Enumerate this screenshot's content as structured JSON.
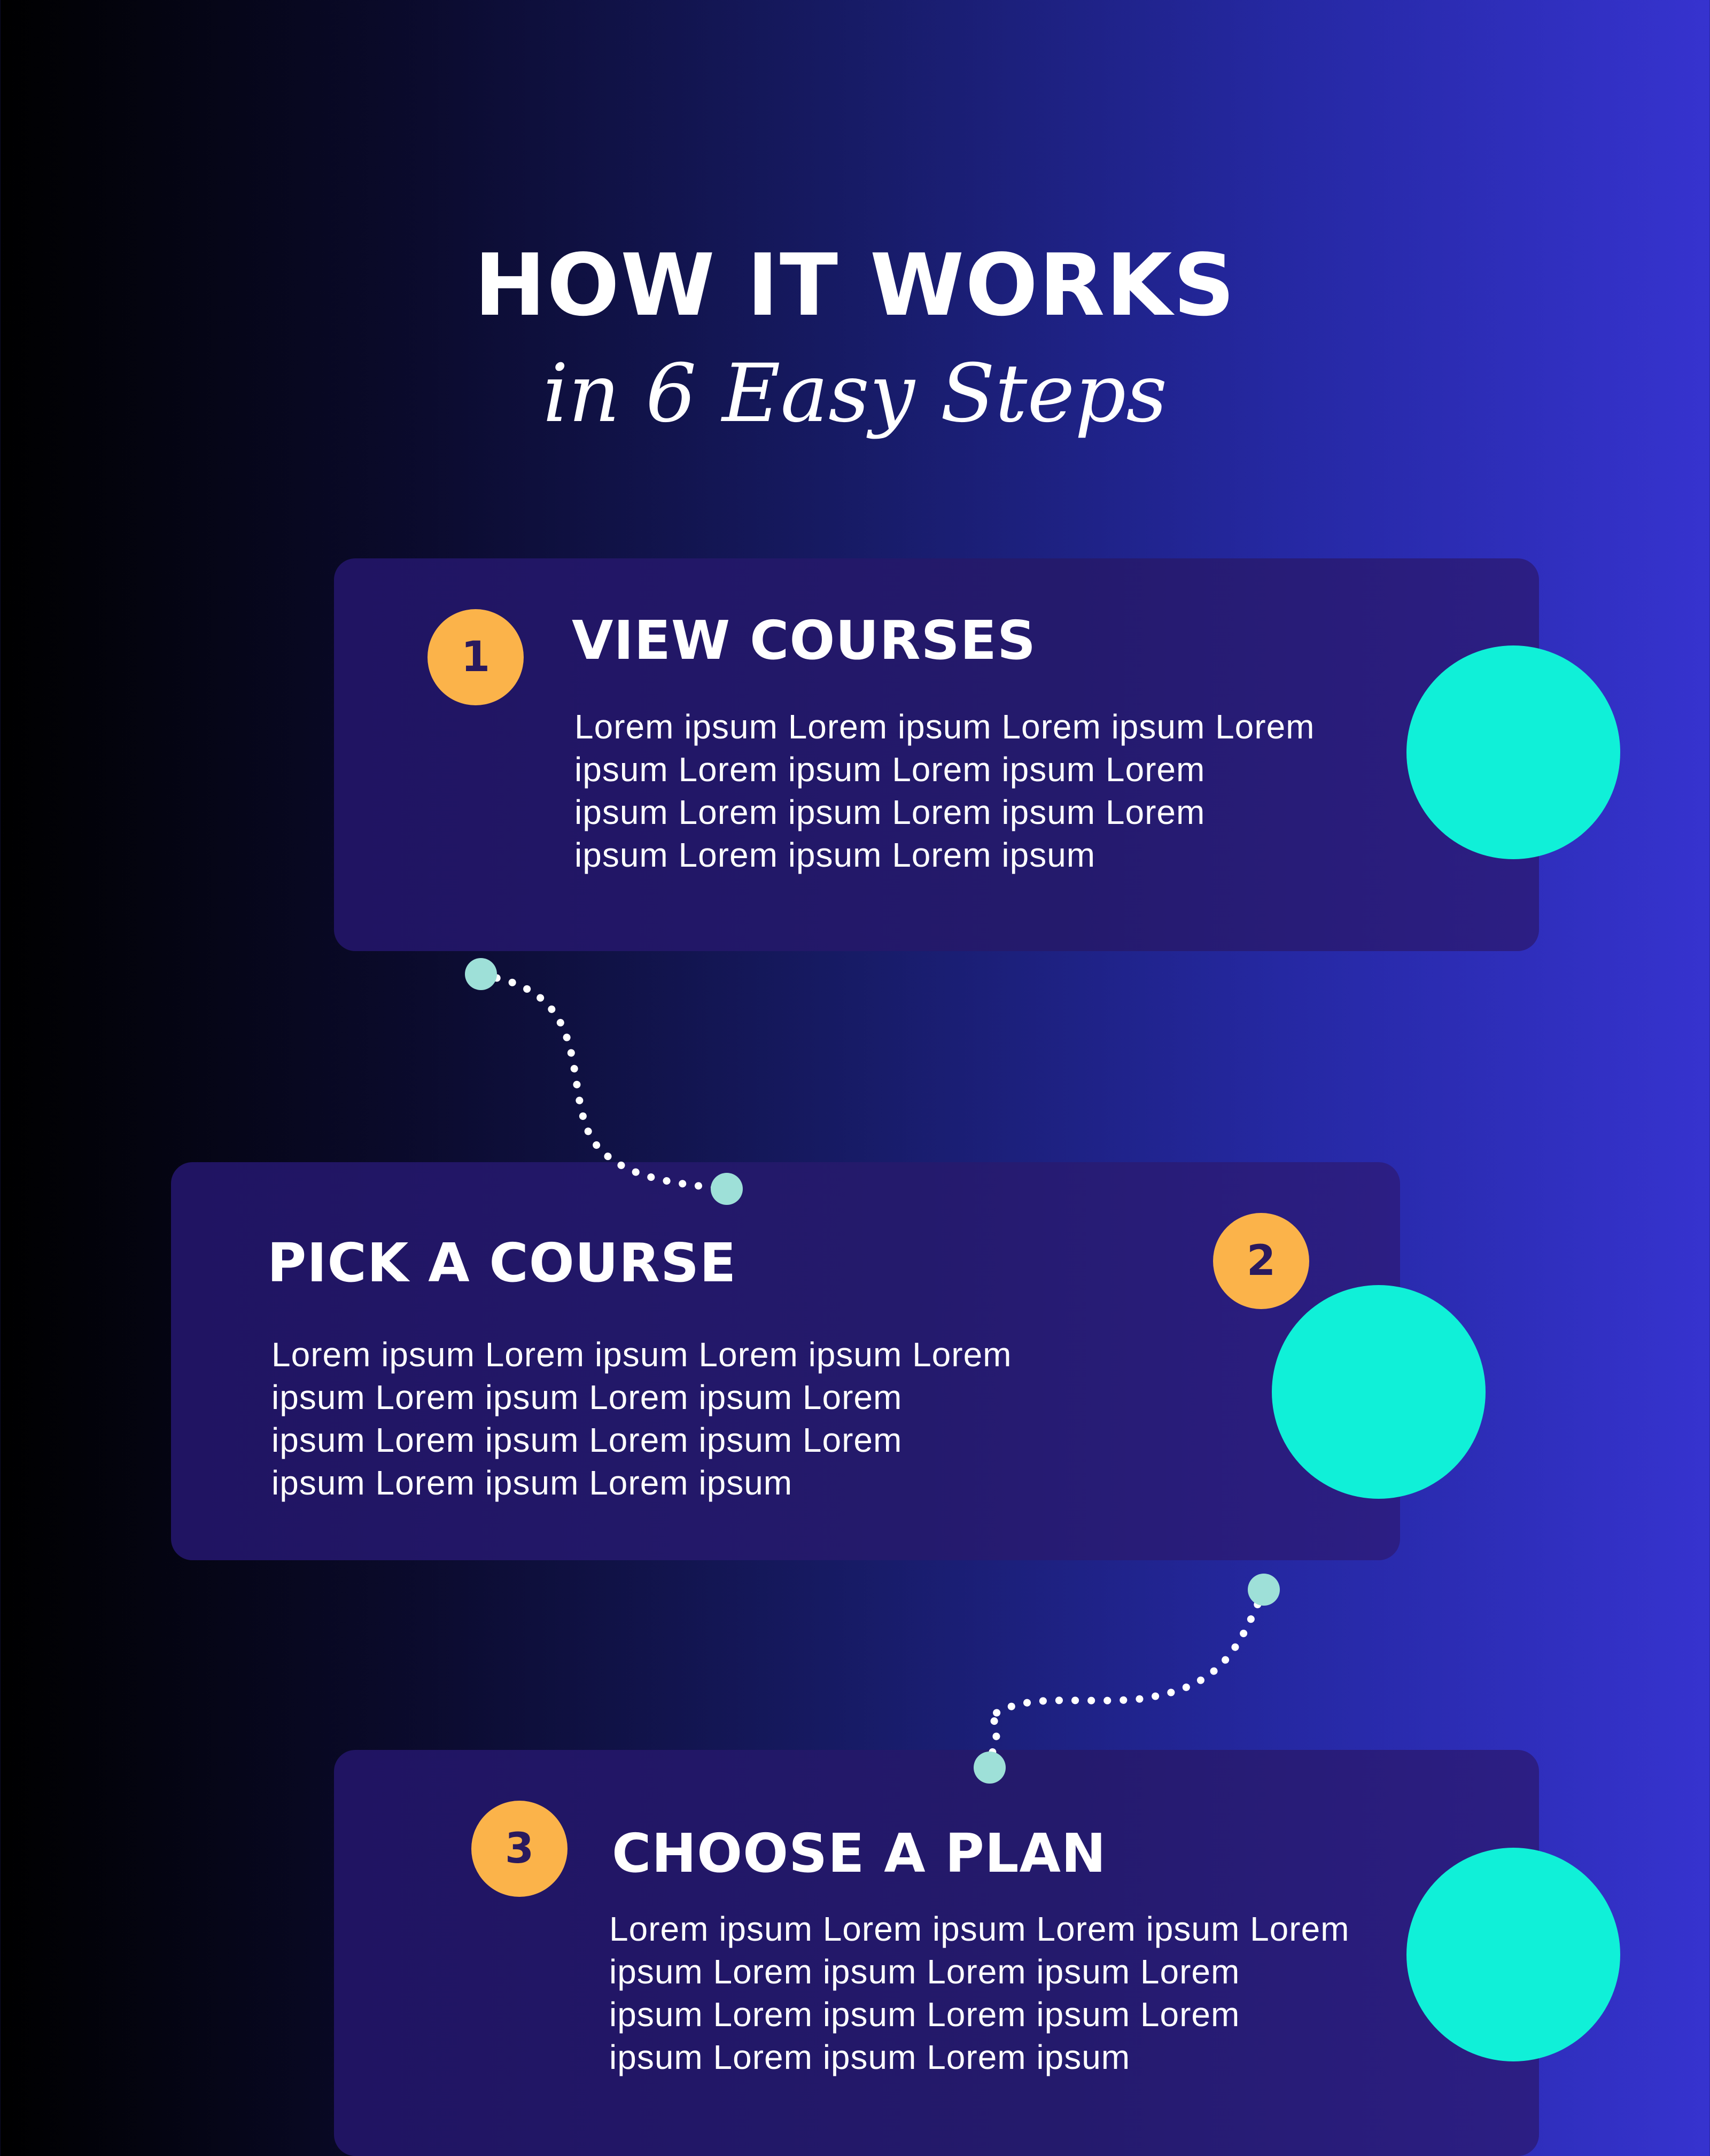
{
  "header": {
    "title": "HOW IT WORKS",
    "subtitle": "in 6 Easy Steps"
  },
  "steps": [
    {
      "number": "1",
      "heading": "VIEW COURSES",
      "body": "Lorem ipsum Lorem ipsum  Lorem ipsum  Lorem\nipsum  Lorem ipsum  Lorem ipsum  Lorem\nipsum  Lorem ipsum  Lorem ipsum  Lorem\nipsum  Lorem ipsum  Lorem ipsum"
    },
    {
      "number": "2",
      "heading": "PICK A COURSE",
      "body": "Lorem ipsum Lorem ipsum  Lorem ipsum  Lorem\nipsum  Lorem ipsum  Lorem ipsum  Lorem\nipsum  Lorem ipsum  Lorem ipsum  Lorem\nipsum  Lorem ipsum  Lorem ipsum"
    },
    {
      "number": "3",
      "heading": "CHOOSE A PLAN",
      "body": "Lorem ipsum Lorem ipsum  Lorem ipsum  Lorem\nipsum  Lorem ipsum  Lorem ipsum  Lorem\nipsum  Lorem ipsum  Lorem ipsum  Lorem\nipsum  Lorem ipsum  Lorem ipsum"
    }
  ],
  "colors": {
    "badge": "#fbb34a",
    "accent_circle": "#10f0d8",
    "connector_dot": "#9ee0d8"
  }
}
